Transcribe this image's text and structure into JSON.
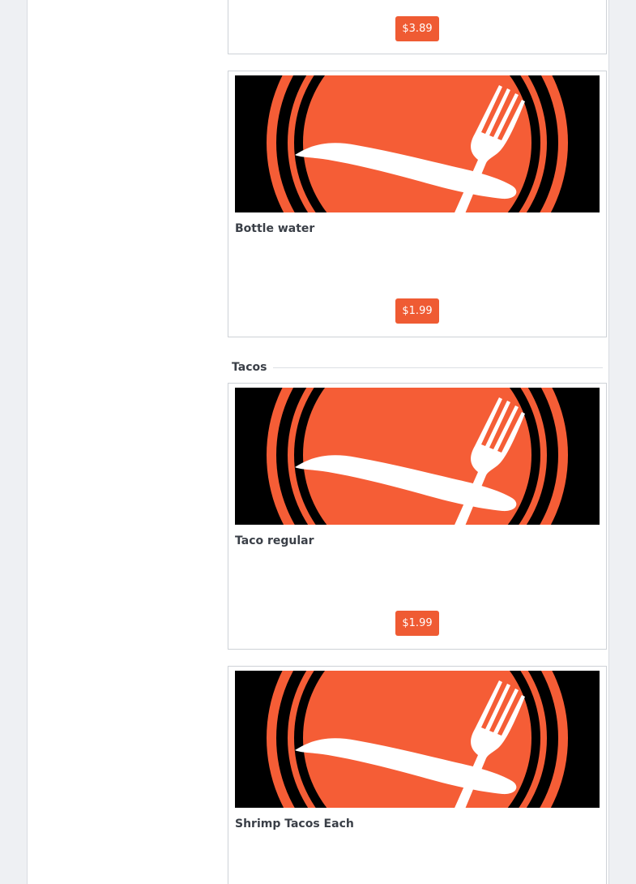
{
  "colors": {
    "accent": "#ef5b33",
    "image_background": "#000000",
    "text": "#3a3f47"
  },
  "cards": [
    {
      "title": "",
      "price": "$3.89",
      "image_icon": "plate-fork-knife-icon"
    },
    {
      "title": "Bottle water",
      "price": "$1.99",
      "image_icon": "plate-fork-knife-icon"
    },
    {
      "title": "Taco regular",
      "price": "$1.99",
      "image_icon": "plate-fork-knife-icon"
    },
    {
      "title": "Shrimp Tacos Each",
      "price": "",
      "image_icon": "plate-fork-knife-icon"
    }
  ],
  "sections": [
    {
      "title": "Tacos"
    }
  ]
}
